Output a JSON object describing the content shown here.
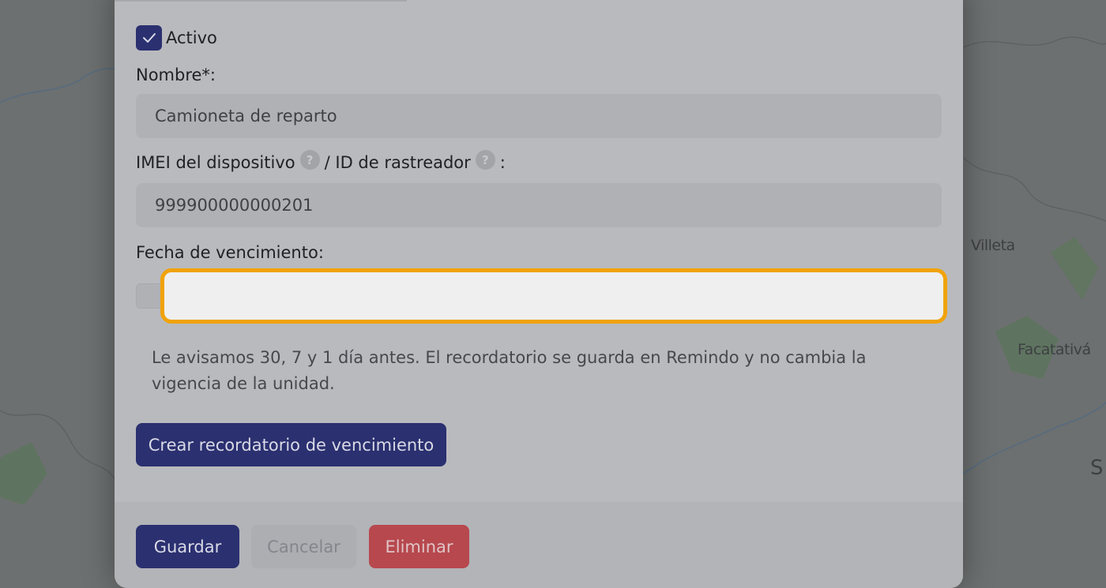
{
  "map": {
    "labels": [
      "Villeta",
      "Facatativá",
      "S"
    ]
  },
  "form": {
    "active": {
      "label": "Activo",
      "checked": true
    },
    "name": {
      "label": "Nombre*:",
      "value": "Camioneta de reparto"
    },
    "imei": {
      "label_part1": "IMEI del dispositivo",
      "label_part2": "/ ID de rastreador",
      "label_part3": ":",
      "help_glyph": "?",
      "value": "999900000000201"
    },
    "expiry": {
      "label": "Fecha de vencimiento:",
      "value": ""
    },
    "hint": "Le avisamos 30, 7 y 1 día antes. El recordatorio se guarda en Remindo y no cambia la vigencia de la unidad.",
    "reminder_button": "Crear recordatorio de vencimiento"
  },
  "footer": {
    "save": "Guardar",
    "cancel": "Cancelar",
    "delete": "Eliminar"
  },
  "colors": {
    "primary": "#2b3070",
    "danger": "#b7484e",
    "focus": "#f0a30a"
  }
}
